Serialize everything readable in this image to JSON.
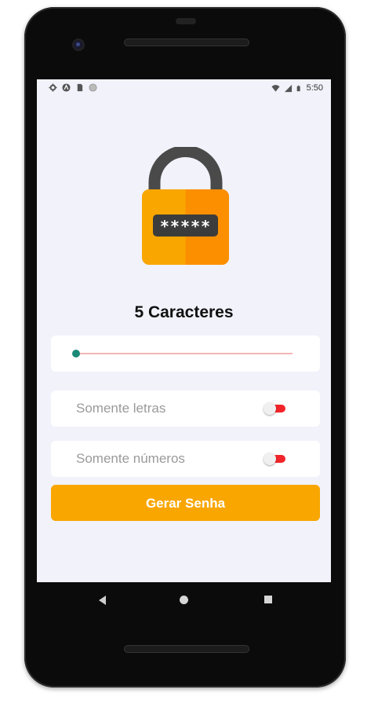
{
  "status_bar": {
    "time": "5:50",
    "left_icons": [
      "gear-icon",
      "app-icon",
      "sim-card-icon",
      "dot-icon"
    ],
    "right_icons": [
      "wifi-icon",
      "signal-icon",
      "battery-icon"
    ]
  },
  "app": {
    "title": "5 Caracteres",
    "slider": {
      "value": 5
    },
    "options": [
      {
        "label": "Somente letras",
        "enabled": false
      },
      {
        "label": "Somente números",
        "enabled": false
      }
    ],
    "generate_button_label": "Gerar Senha",
    "lock_code_mask": "*****"
  },
  "colors": {
    "accent": "#F9A600",
    "background": "#F2F2FB",
    "slider_thumb": "#1B8A78",
    "slider_track": "#F4B5B5",
    "toggle_track": "#F2242A",
    "lock_body": "#F9A600",
    "lock_shackle": "#4A4A4A"
  },
  "nav_bar": [
    "back-icon",
    "home-icon",
    "recent-apps-icon"
  ]
}
